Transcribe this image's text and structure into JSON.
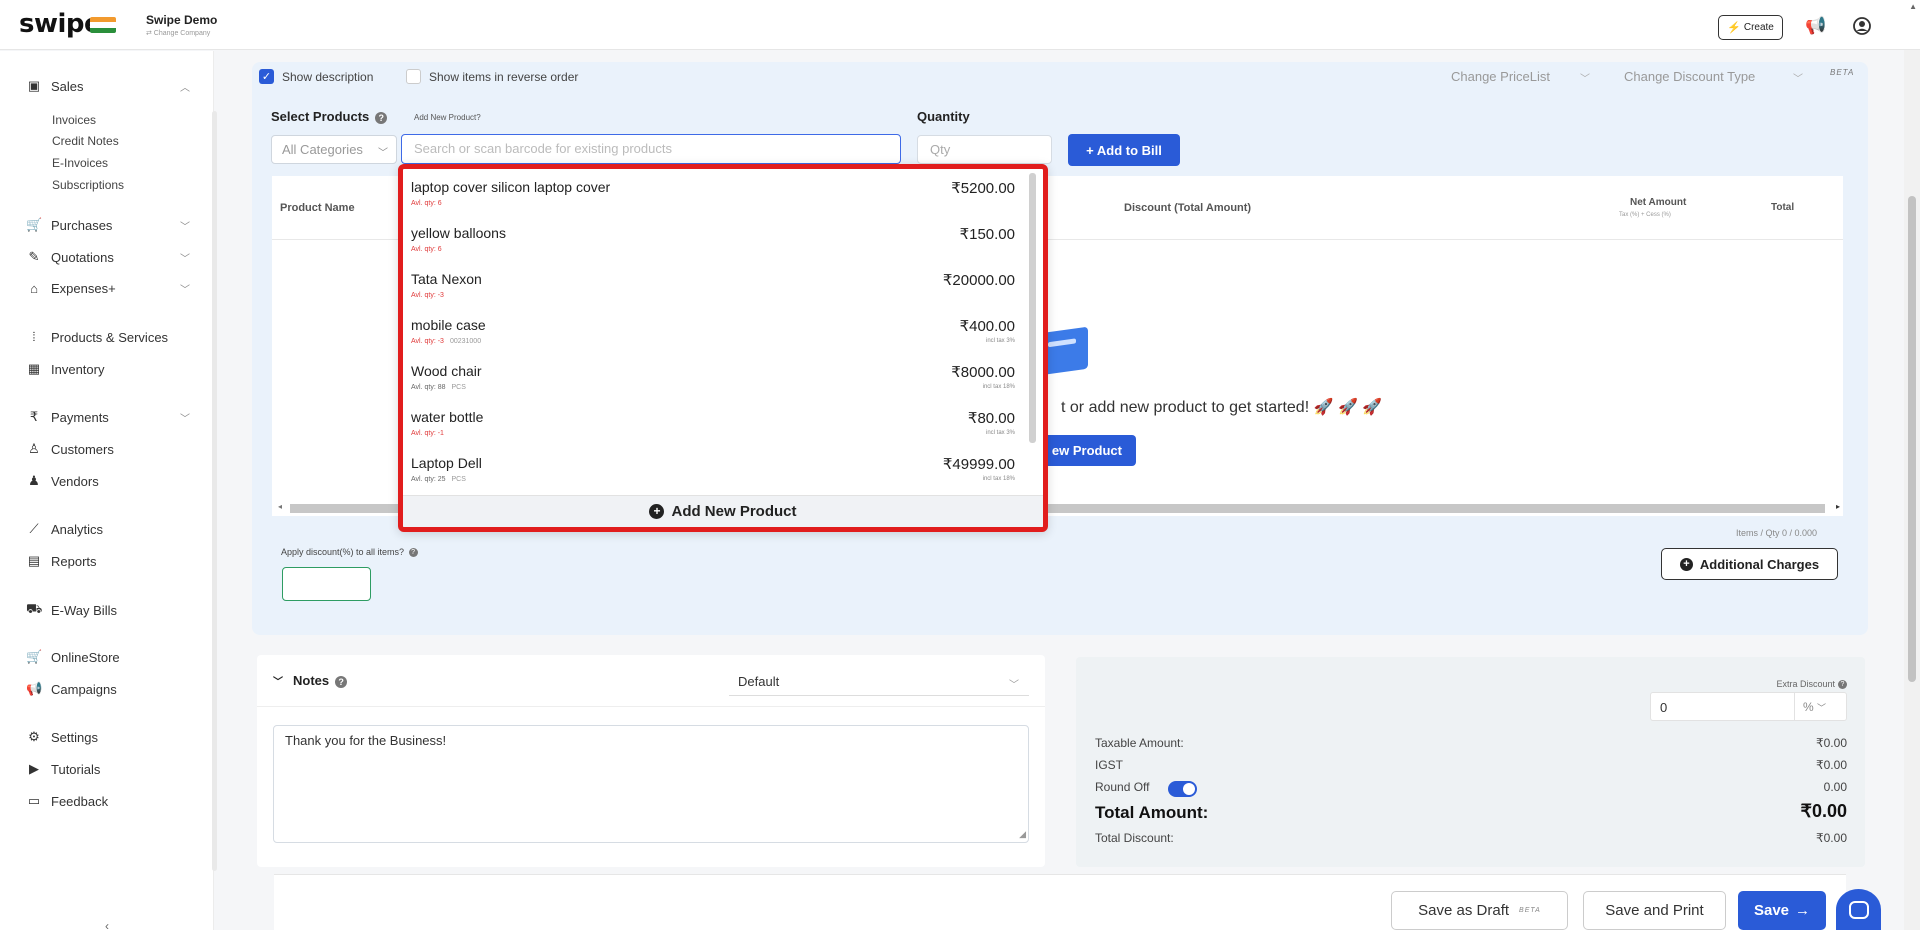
{
  "app": {
    "logo": "swipe",
    "company_name": "Swipe Demo",
    "company_sub": "⇄ Change Company",
    "create_label": "Create"
  },
  "sidebar": {
    "sales": "Sales",
    "sales_sub": [
      "Invoices",
      "Credit Notes",
      "E-Invoices",
      "Subscriptions"
    ],
    "purchases": "Purchases",
    "quotations": "Quotations",
    "expenses": "Expenses+",
    "products": "Products & Services",
    "inventory": "Inventory",
    "payments": "Payments",
    "customers": "Customers",
    "vendors": "Vendors",
    "analytics": "Analytics",
    "reports": "Reports",
    "eway": "E-Way Bills",
    "onlinestore": "OnlineStore",
    "campaigns": "Campaigns",
    "settings": "Settings",
    "tutorials": "Tutorials",
    "feedback": "Feedback"
  },
  "options": {
    "show_description": "Show description",
    "reverse_order": "Show items in reverse order",
    "change_pricelist": "Change PriceList",
    "change_discount": "Change Discount Type",
    "beta": "BETA"
  },
  "product_entry": {
    "select_products": "Select Products",
    "add_new_link": "Add New Product?",
    "quantity": "Quantity",
    "category_placeholder": "All Categories",
    "search_placeholder": "Search or scan barcode for existing products",
    "qty_placeholder": "Qty",
    "add_to_bill": "+ Add to Bill"
  },
  "table": {
    "col_product": "Product Name",
    "col_discount": "Discount (Total Amount)",
    "col_net": "Net Amount",
    "col_net_sub": "Tax (%) + Cess (%)",
    "col_total": "Total",
    "empty_message": "t or add new product to get started! 🚀 🚀 🚀",
    "add_new_product_btn": "ew Product",
    "items_qty": "Items / Qty 0 / 0.000",
    "apply_discount": "Apply discount(%) to all items?",
    "additional_charges": "Additional Charges"
  },
  "dropdown": {
    "items": [
      {
        "name": "laptop cover silicon laptop cover",
        "sub": "Avl. qty: 6",
        "code": "",
        "price": "₹5200.00",
        "tax": "",
        "low": true
      },
      {
        "name": "yellow balloons",
        "sub": "Avl. qty: 6",
        "code": "",
        "price": "₹150.00",
        "tax": "",
        "low": true
      },
      {
        "name": "Tata Nexon",
        "sub": "Avl. qty: -3",
        "code": "",
        "price": "₹20000.00",
        "tax": "",
        "low": true
      },
      {
        "name": "mobile case",
        "sub": "Avl. qty: -3",
        "code": "00231000",
        "price": "₹400.00",
        "tax": "incl tax 3%",
        "low": true
      },
      {
        "name": "Wood chair",
        "sub": "Avl. qty: 88",
        "code": "PCS",
        "price": "₹8000.00",
        "tax": "incl tax 18%",
        "low": false
      },
      {
        "name": "water bottle",
        "sub": "Avl. qty: -1",
        "code": "",
        "price": "₹80.00",
        "tax": "incl tax 3%",
        "low": true
      },
      {
        "name": "Laptop Dell",
        "sub": "Avl. qty: 25",
        "code": "PCS",
        "price": "₹49999.00",
        "tax": "incl tax 18%",
        "low": false
      }
    ],
    "footer": "Add New Product"
  },
  "notes": {
    "title": "Notes",
    "template": "Default",
    "text": "Thank you for the Business!"
  },
  "totals": {
    "extra_discount_label": "Extra Discount",
    "extra_discount_value": "0",
    "extra_discount_unit": "%",
    "taxable_label": "Taxable Amount:",
    "taxable_value": "₹0.00",
    "igst_label": "IGST",
    "igst_value": "₹0.00",
    "roundoff_label": "Round Off",
    "roundoff_value": "0.00",
    "total_label": "Total Amount:",
    "total_value": "₹0.00",
    "discount_label": "Total Discount:",
    "discount_value": "₹0.00"
  },
  "actions": {
    "save_draft": "Save as Draft",
    "beta": "BETA",
    "save_print": "Save and Print",
    "save": "Save"
  },
  "colors": {
    "primary": "#2a5bd7",
    "highlight_border": "#e11d1d",
    "card_bg": "#eaf2fb",
    "low_stock": "#e03a3a"
  }
}
